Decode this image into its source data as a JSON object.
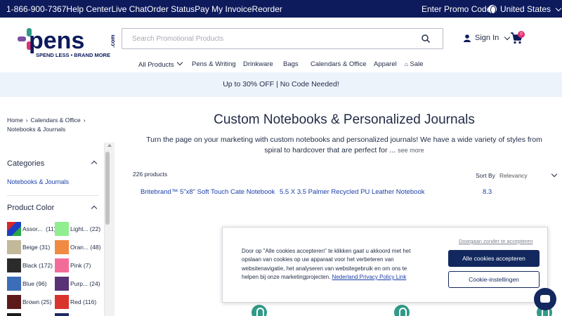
{
  "topbar": {
    "links": [
      "1-866-900-7367",
      "Help Center",
      "Live Chat",
      "Order Status",
      "Pay My Invoice",
      "Reorder"
    ],
    "promo_code": "Enter Promo Code",
    "country": "United States"
  },
  "brand": {
    "logo_text": "pens",
    "logo_tld": ".com",
    "tagline": "SPEND LESS • BRAND MORE"
  },
  "search": {
    "placeholder": "Search Promotional Products",
    "value": ""
  },
  "account": {
    "signin": "Sign In",
    "cart_count": "0"
  },
  "nav": {
    "items": [
      "All Products",
      "Pens & Writing",
      "Drinkware",
      "Bags",
      "Calendars & Office",
      "Apparel",
      "Sale"
    ]
  },
  "promo_banner": "Up to 30% OFF | No Code Needed!",
  "breadcrumb": {
    "home": "Home",
    "parent": "Calendars & Office",
    "current": "Notebooks & Journals"
  },
  "sidebar": {
    "categories_heading": "Categories",
    "category_link": "Notebooks & Journals",
    "color_heading": "Product Color",
    "colors": [
      {
        "label": "Assor...",
        "count": "(11)",
        "hex": "multi"
      },
      {
        "label": "Light...",
        "count": "(22)",
        "hex": "#90ee90"
      },
      {
        "label": "Beige",
        "count": "(31)",
        "hex": "#c2b89a"
      },
      {
        "label": "Oran...",
        "count": "(48)",
        "hex": "#f18a42"
      },
      {
        "label": "Black",
        "count": "(172)",
        "hex": "#2b2b2b"
      },
      {
        "label": "Pink",
        "count": "(7)",
        "hex": "#f36c99"
      },
      {
        "label": "Blue",
        "count": "(96)",
        "hex": "#3b6db8"
      },
      {
        "label": "Purp...",
        "count": "(24)",
        "hex": "#5a3276"
      },
      {
        "label": "Brown",
        "count": "(25)",
        "hex": "#5c1a1a"
      },
      {
        "label": "Red",
        "count": "(116)",
        "hex": "#d9342b"
      }
    ]
  },
  "main": {
    "title": "Custom Notebooks & Personalized Journals",
    "description": "Turn the page on your marketing with custom notebooks and personalized journals! We have a wide variety of styles from spiral to hardcover that are perfect for ...",
    "see_more": "see more",
    "product_count": "226 products",
    "sort_label": "Sort By",
    "sort_value": "Relevancy",
    "products": [
      "Britebrand™ 5\"x8\" Soft Touch Cate Notebook",
      "5.5 X 3.5 Palmer Recycled PU Leather Notebook",
      "8.3"
    ]
  },
  "cookie": {
    "reject": "Doorgaan zonder te accepteren",
    "text": "Door op \"Alle cookies accepteren\" te klikken gaat u akkoord met het opslaan van cookies op uw apparaat voor het verbeteren van websitenavigatie, het analyseren van websitegebruik en om ons te helpen bij onze marketingprojecten.",
    "policy_link": "Nederland Privacy Policy Link",
    "accept_all": "Alle cookies accepteren",
    "settings": "Cookie-instellingen"
  },
  "colors": {
    "navy": "#0d1a5c",
    "link_blue": "#1b3fa8",
    "promo_bg": "#edf3fb",
    "brand_pink": "#e3306f",
    "brand_teal": "#2f9b87"
  }
}
